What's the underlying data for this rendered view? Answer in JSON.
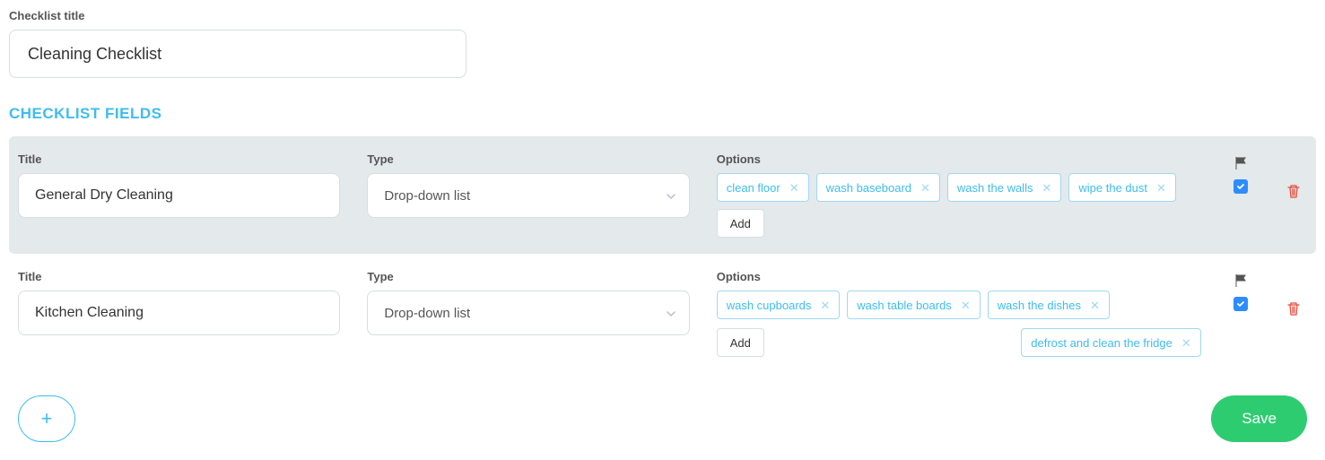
{
  "header": {
    "checklist_title_label": "Checklist title",
    "checklist_title_value": "Cleaning Checklist"
  },
  "section_heading": "CHECKLIST FIELDS",
  "columns": {
    "title": "Title",
    "type": "Type",
    "options": "Options"
  },
  "type_options": [
    "Drop-down list"
  ],
  "fields": [
    {
      "title": "General Dry Cleaning",
      "type": "Drop-down list",
      "options_row1": [
        "clean floor",
        "wash baseboard",
        "wash the walls",
        "wipe the dust"
      ],
      "options_row2": [],
      "add_label": "Add",
      "flag_checked": true,
      "highlighted": true
    },
    {
      "title": "Kitchen Cleaning",
      "type": "Drop-down list",
      "options_row1": [
        "wash cupboards",
        "wash table boards",
        "wash the dishes"
      ],
      "options_row2": [
        "defrost and clean the fridge"
      ],
      "add_label": "Add",
      "flag_checked": true,
      "highlighted": false
    }
  ],
  "buttons": {
    "save": "Save"
  }
}
